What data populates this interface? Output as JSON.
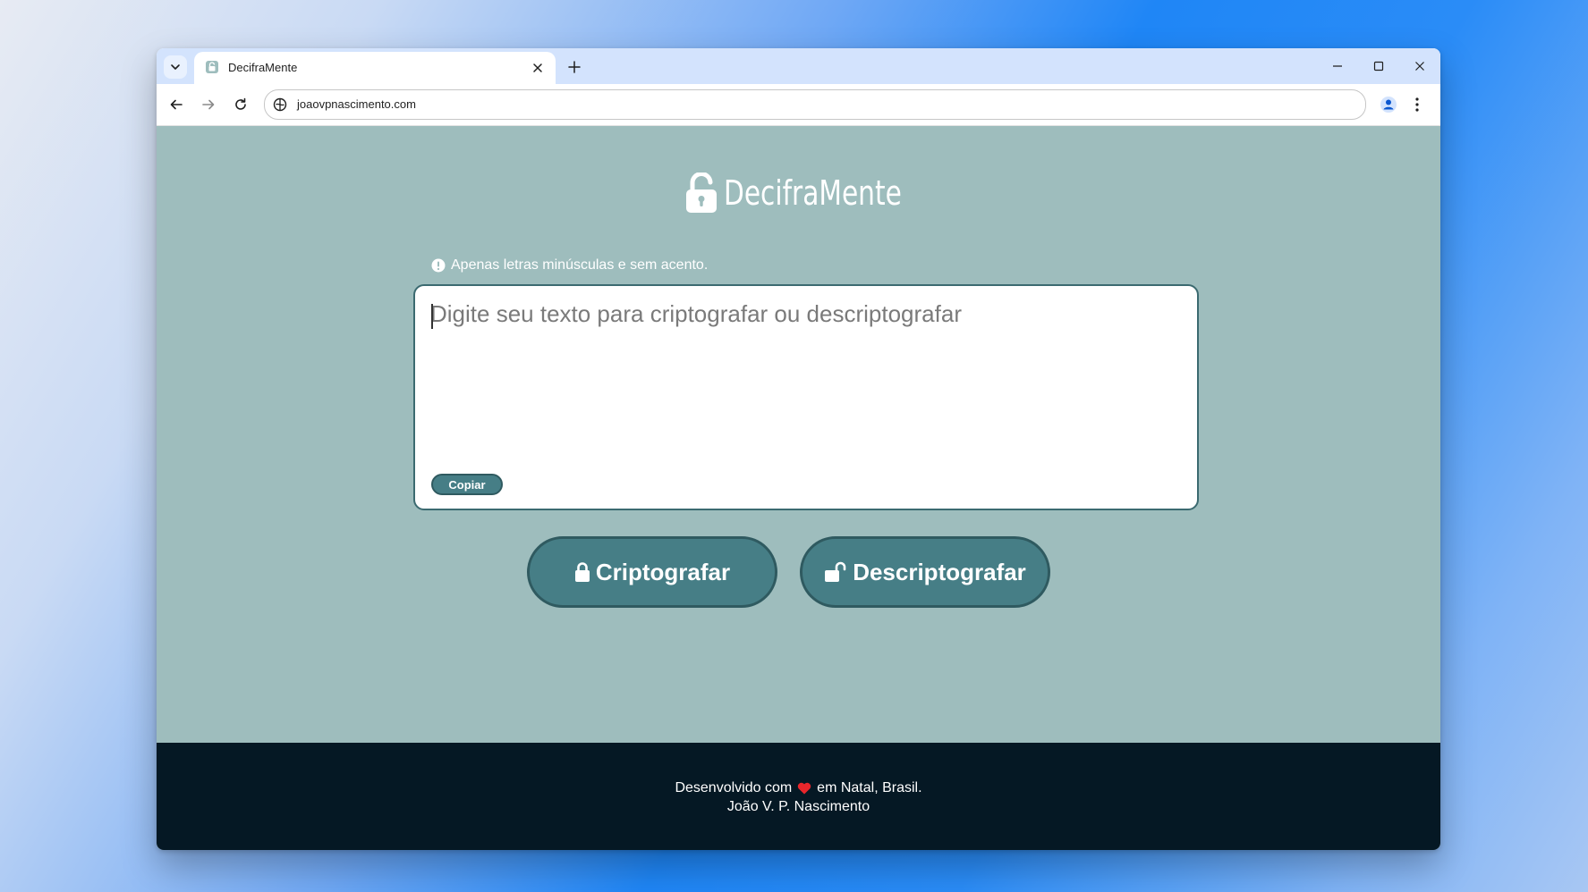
{
  "browser": {
    "tab_title": "DecifraMente",
    "url": "joaovpnascimento.com"
  },
  "page": {
    "logo_text": "DecifraMente",
    "hint": "Apenas letras minúsculas e sem acento.",
    "textarea_placeholder": "Digite seu texto para criptografar ou descriptografar",
    "textarea_value": "",
    "copy_label": "Copiar",
    "encrypt_label": "Criptografar",
    "decrypt_label": "Descriptografar"
  },
  "footer": {
    "line1_before": "Desenvolvido com",
    "line1_after": "em Natal, Brasil.",
    "line2": "João V. P. Nascimento"
  },
  "colors": {
    "page_background": "#9ebdbd",
    "button": "#467e86",
    "button_border": "#2f5a60",
    "footer_background": "#051824",
    "heart": "#e8262b"
  },
  "icons": {
    "tab_dropdown": "chevron-down-icon",
    "tab_favicon": "lock-favicon-icon",
    "tab_close": "close-icon",
    "new_tab": "plus-icon",
    "back": "arrow-left-icon",
    "forward": "arrow-right-icon",
    "reload": "reload-icon",
    "site_info": "site-info-icon",
    "profile": "profile-icon",
    "menu": "kebab-menu-icon",
    "logo": "unlocked-padlock-icon",
    "hint": "info-circle-icon",
    "encrypt": "locked-padlock-icon",
    "decrypt": "unlocked-padlock-icon",
    "heart": "heart-icon"
  }
}
